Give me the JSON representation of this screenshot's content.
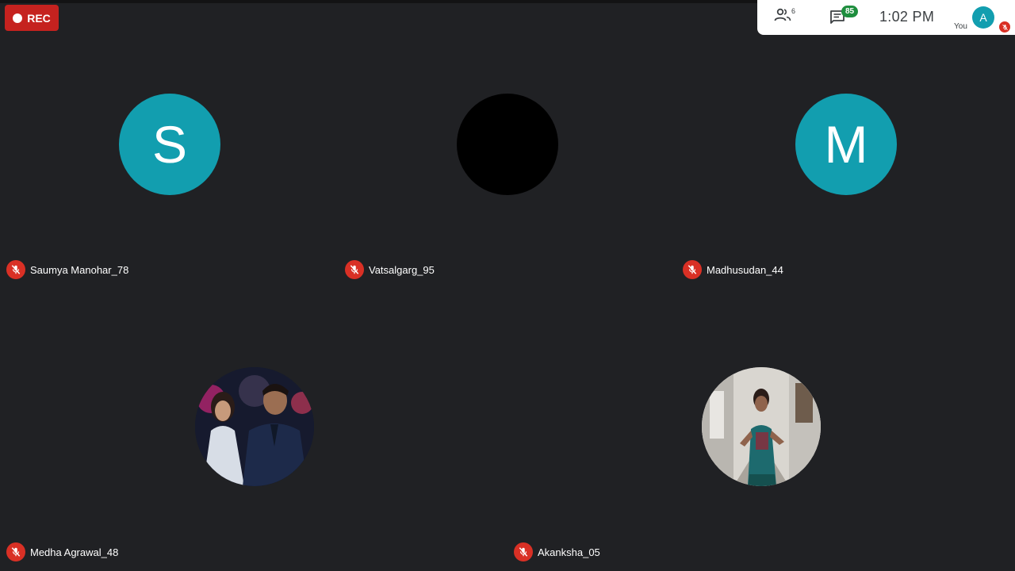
{
  "recording": {
    "label": "REC",
    "color": "#c5221f"
  },
  "topbar": {
    "people_icon": "people-icon",
    "people_count": "6",
    "chat_icon": "chat-icon",
    "chat_badge": "85",
    "clock": "1:02  PM",
    "self": {
      "initial": "A",
      "label": "You",
      "mic_icon": "mic-off-icon",
      "avatar_color": "#129eaf"
    }
  },
  "participants": [
    {
      "name": "Saumya Manohar_78",
      "avatar": {
        "type": "letter",
        "text": "S",
        "color": "#129eaf"
      },
      "mic_icon": "mic-off-icon"
    },
    {
      "name": "Vatsalgarg_95",
      "avatar": {
        "type": "blank",
        "text": "",
        "color": "#000000"
      },
      "mic_icon": "mic-off-icon"
    },
    {
      "name": "Madhusudan_44",
      "avatar": {
        "type": "letter",
        "text": "M",
        "color": "#129eaf"
      },
      "mic_icon": "mic-off-icon"
    },
    {
      "name": "Medha Agrawal_48",
      "avatar": {
        "type": "photo",
        "text": "",
        "color": "#0b1a3a"
      },
      "mic_icon": "mic-off-icon"
    },
    {
      "name": "Akanksha_05",
      "avatar": {
        "type": "photo",
        "text": "",
        "color": "#cfcfcf"
      },
      "mic_icon": "mic-off-icon"
    }
  ],
  "theme": {
    "background": "#202124",
    "mic_off_color": "#d93025",
    "badge_color": "#1e8e3e"
  }
}
